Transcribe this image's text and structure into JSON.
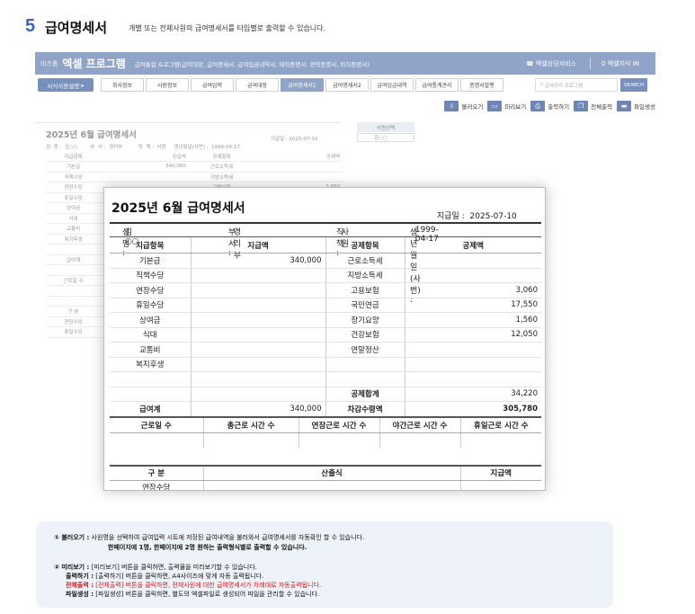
{
  "section": {
    "number": "5",
    "title": "급여명세서",
    "description": "개별 또는 전체사원의 급여명세서를 타입별로 출력할 수 있습니다."
  },
  "app": {
    "brand_small": "비즈폼",
    "brand": "엑셀 프로그램",
    "brand_desc": "급여통합 프로그램(급여대장, 급여명세서, 급여입금내역서, 재직증명서, 경력증명서, 퇴직증명서)",
    "service_link": "엑셀상담서비스",
    "knowledge_link": "엑셀지식 IN",
    "guide_button": "서식사용설명",
    "tabs": [
      "회사정보",
      "사원정보",
      "급여입력",
      "급여대장",
      "급여명세서1",
      "급여명세서2",
      "급여입금내역",
      "급여통계관리",
      "증명서발행"
    ],
    "active_tab_index": 4,
    "search_placeholder": "급여관리 프로그램",
    "search_button": "SEARCH",
    "toolbar": [
      "불러오기",
      "미리보기",
      "출력하기",
      "전체출력",
      "파일생성"
    ],
    "bg_title": "2025년 6월 급여명세서",
    "bg_date": "지급일 : 2025-07-10",
    "bg_info": "성  명 :  김○○        부  서 :  경리부          직  책 :  사원     생년월일(사번) :  1999-04-17",
    "bg_rows": [
      [
        "지급항목",
        "지급액",
        "공제항목",
        "공제액"
      ],
      [
        "기본급",
        "340,000",
        "근로소득세",
        ""
      ],
      [
        "직책수당",
        "",
        "지방소득세",
        ""
      ],
      [
        "연장수당",
        "",
        "고용보험",
        "3,060"
      ],
      [
        "휴일수당",
        "",
        "",
        ""
      ],
      [
        "상여금",
        "",
        "",
        ""
      ],
      [
        "식대",
        "",
        "",
        ""
      ],
      [
        "교통비",
        "",
        "",
        ""
      ],
      [
        "복지후생",
        "",
        "",
        ""
      ],
      [
        "",
        "",
        "",
        ""
      ],
      [
        "급여계",
        "",
        "",
        ""
      ],
      [
        "",
        "",
        "",
        ""
      ],
      [
        "근로일 수",
        "",
        "",
        ""
      ],
      [
        "",
        "",
        "",
        ""
      ],
      [
        "",
        "",
        "",
        ""
      ],
      [
        "구  분",
        "",
        "",
        ""
      ],
      [
        "연장수당",
        "",
        "",
        ""
      ],
      [
        "휴일수당",
        "",
        "",
        ""
      ]
    ],
    "employee_select_label": "사원선택",
    "employee_select_value": "김○○"
  },
  "payslip": {
    "title": "2025년 6월 급여명세서",
    "pay_date_label": "지급일 :",
    "pay_date": "2025-07-10",
    "name_label": "성 명 :",
    "name": "김○○",
    "dept_label": "부 서 :",
    "dept": "경리부",
    "position_label": "직 책 :",
    "position": "사원",
    "birth_label": "생년월일(사번) :",
    "birth": "1999-04-17",
    "headers": [
      "지급항목",
      "지급액",
      "공제항목",
      "공제액"
    ],
    "rows": [
      [
        "기본급",
        "340,000",
        "근로소득세",
        ""
      ],
      [
        "직책수당",
        "",
        "지방소득세",
        ""
      ],
      [
        "연장수당",
        "",
        "고용보험",
        "3,060"
      ],
      [
        "휴일수당",
        "",
        "국민연금",
        "17,550"
      ],
      [
        "상여금",
        "",
        "장기요양",
        "1,560"
      ],
      [
        "식대",
        "",
        "건강보험",
        "12,050"
      ],
      [
        "교통비",
        "",
        "연말정산",
        ""
      ],
      [
        "복지후생",
        "",
        "",
        ""
      ],
      [
        "",
        "",
        "",
        ""
      ]
    ],
    "deduct_total_label": "공제합계",
    "deduct_total": "34,220",
    "gross_label": "급여계",
    "gross": "340,000",
    "net_label": "차감수령액",
    "net": "305,780",
    "work_headers": [
      "근로일 수",
      "총근로 시간 수",
      "연장근로 시간 수",
      "야간근로 시간 수",
      "휴일근로 시간 수"
    ],
    "calc_headers": [
      "구  분",
      "산출식",
      "지급액"
    ],
    "calc_first_row": "연장수당"
  },
  "notes": {
    "n1_key": "① 불러오기 :",
    "n1_line1": "사원명을 선택하여 급여입력 시트에 저장된 급여내역을 불러와서 급여명세서를 자동확인 할 수 있습니다.",
    "n1_line2": "한페이지에 1명, 한페이지에 2명 원하는 출력형식별로 출력할 수 있습니다.",
    "n2_key": "② 미리보기 :",
    "n2_text": "[미리보기] 버튼을 클릭하면, 출력물을 미리보기할 수 있습니다.",
    "n3_key": "출력하기 :",
    "n3_text": "[출력하기] 버튼을 클릭하면, A4사이즈에 맞게 자동 출력됩니다.",
    "n4_key": "전체출력 :",
    "n4_text": "[전체출력] 버튼을 클릭하면, 전체사원에 대한 급여명세서가 차례대로 자동출력됩니다.",
    "n5_key": "파일생성 :",
    "n5_text": "[파일생성] 버튼을 클릭하면, 별도의 엑셀파일로 생성되어 파일을 관리할 수 있습니다."
  }
}
